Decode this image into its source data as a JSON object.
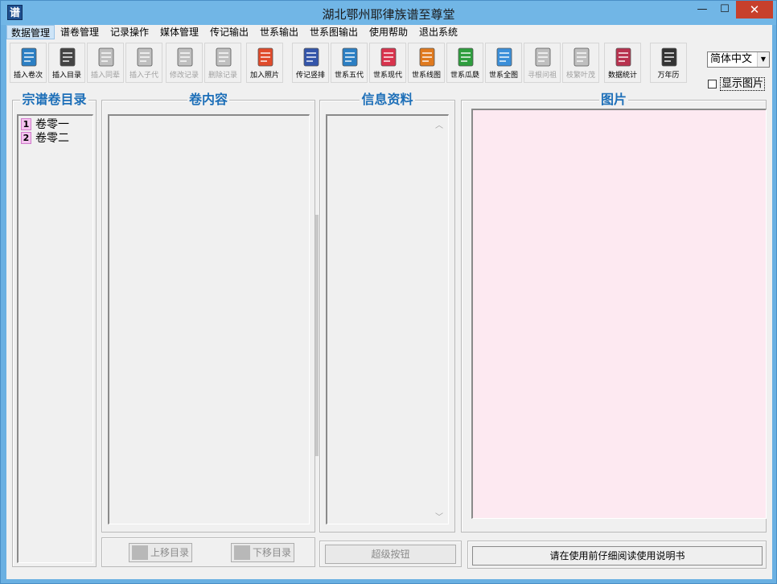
{
  "window": {
    "icon_text": "谱",
    "title": "湖北鄂州耶律族谱至尊堂",
    "min_glyph": "—",
    "max_glyph": "☐",
    "close_glyph": "✕"
  },
  "menu": [
    {
      "label": "数据管理",
      "active": true
    },
    {
      "label": "谱卷管理"
    },
    {
      "label": "记录操作"
    },
    {
      "label": "媒体管理"
    },
    {
      "label": "传记输出"
    },
    {
      "label": "世系输出"
    },
    {
      "label": "世系图输出"
    },
    {
      "label": "使用帮助"
    },
    {
      "label": "退出系统"
    }
  ],
  "toolbar": [
    {
      "label": "插入卷次",
      "icon": "notepad-pencil-icon",
      "color": "#2b7fc4",
      "enabled": true
    },
    {
      "label": "插入目录",
      "icon": "quill-pen-icon",
      "color": "#444444",
      "enabled": true
    },
    {
      "label": "插入同辈",
      "icon": "document-icon",
      "color": "#bfbfbf",
      "enabled": false
    },
    {
      "label": "插入子代",
      "icon": "document-icon",
      "color": "#bfbfbf",
      "enabled": false
    },
    {
      "label": "修改记录",
      "icon": "document-edit-icon",
      "color": "#bfbfbf",
      "enabled": false
    },
    {
      "label": "删除记录",
      "icon": "document-delete-icon",
      "color": "#bfbfbf",
      "enabled": false
    },
    {
      "label": "加入照片",
      "icon": "download-arrow-icon",
      "color": "#e04b2b",
      "enabled": true
    },
    {
      "label": "传记竖排",
      "icon": "printer-icon",
      "color": "#3355aa",
      "enabled": true
    },
    {
      "label": "世系五代",
      "icon": "printer-icon",
      "color": "#2b7fc4",
      "enabled": true
    },
    {
      "label": "世系现代",
      "icon": "printer-icon",
      "color": "#d9334d",
      "enabled": true
    },
    {
      "label": "世系线图",
      "icon": "chart-book-icon",
      "color": "#e07a1e",
      "enabled": true
    },
    {
      "label": "世系瓜瓞",
      "icon": "help-book-icon",
      "color": "#2e9e3e",
      "enabled": true
    },
    {
      "label": "世系全图",
      "icon": "calendar-grid-icon",
      "color": "#3b8fd9",
      "enabled": true
    },
    {
      "label": "寻根问祖",
      "icon": "arrow-up-icon",
      "color": "#bfbfbf",
      "enabled": false
    },
    {
      "label": "枝繁叶茂",
      "icon": "arrow-down-icon",
      "color": "#bfbfbf",
      "enabled": false
    },
    {
      "label": "数据统计",
      "icon": "calculator-icon",
      "color": "#b8324f",
      "enabled": true
    },
    {
      "label": "万年历",
      "icon": "calendar-clock-icon",
      "color": "#333333",
      "enabled": true
    }
  ],
  "language": {
    "value": "简体中文"
  },
  "show_image": {
    "label": "显示图片",
    "checked": false
  },
  "panels": {
    "catalog": {
      "title": "宗谱卷目录",
      "items": [
        "卷零一",
        "卷零二"
      ],
      "numbers": [
        "1",
        "2"
      ]
    },
    "content": {
      "title": "卷内容"
    },
    "info": {
      "title": "信息资料"
    },
    "picture": {
      "title": "图片",
      "bg": "#fde9f1"
    }
  },
  "buttons": {
    "move_up": "上移目录",
    "move_down": "下移目录",
    "super": "超级按钮",
    "manual": "请在使用前仔细阅读使用说明书"
  }
}
